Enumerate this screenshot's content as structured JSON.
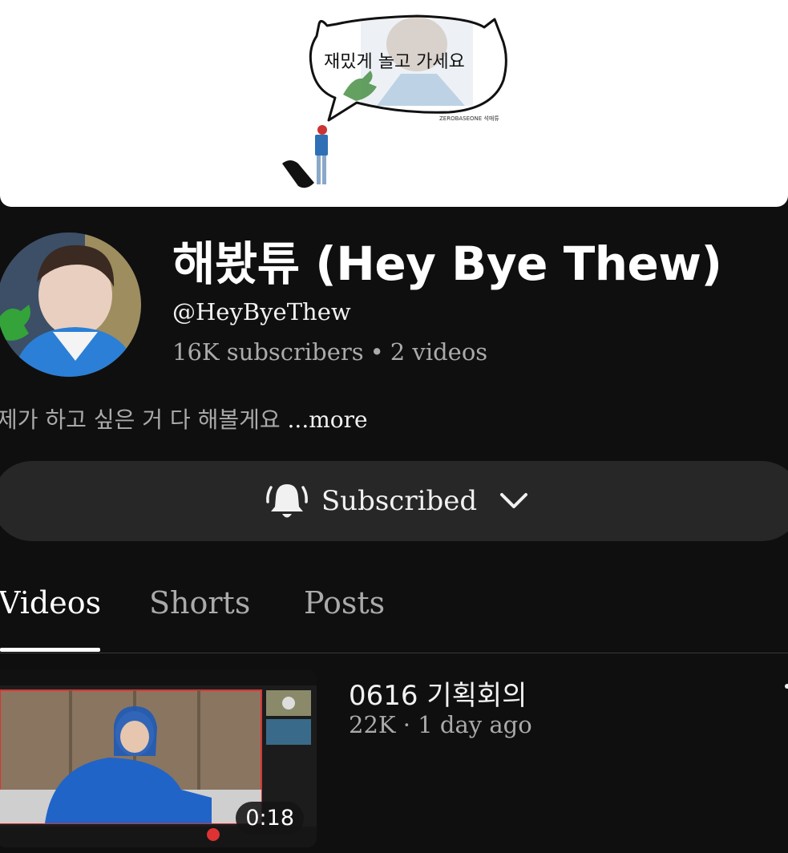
{
  "banner": {
    "bubble_text": "재밌게 놀고 가세요",
    "credit": "ZEROBASEONE 석매튜"
  },
  "channel": {
    "name": "해봤튜 (Hey Bye Thew)",
    "handle": "@HeyByeThew",
    "subscribers": "16K subscribers",
    "separator": "•",
    "videos": "2 videos",
    "description": "제가 하고 싶은 거 다 해볼게요",
    "more_label": "...more"
  },
  "subscribe": {
    "label": "Subscribed",
    "bell_icon": "bell-ringing-icon",
    "chevron_icon": "chevron-down-icon"
  },
  "tabs": [
    {
      "label": "Videos",
      "active": true
    },
    {
      "label": "Shorts",
      "active": false
    },
    {
      "label": "Posts",
      "active": false
    }
  ],
  "videos": [
    {
      "title": "0616 기획회의",
      "meta": "22K · 1 day ago",
      "duration": "0:18"
    }
  ],
  "colors": {
    "background": "#0f0f0f",
    "button": "#272727",
    "text_primary": "#f1f1f1",
    "text_secondary": "#aaaaaa"
  }
}
